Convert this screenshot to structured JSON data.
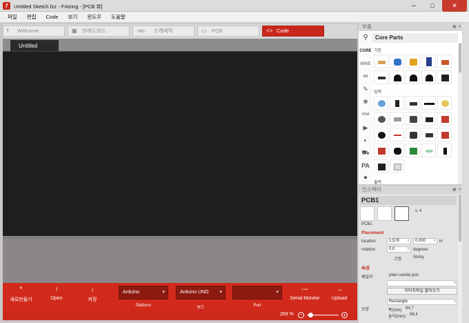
{
  "window": {
    "title": "Untitled Sketch.fzz - Fritzing - [PCB 뷰]",
    "logo_letter": "f",
    "minimize_icon": "─",
    "maximize_icon": "□",
    "close_icon": "✕"
  },
  "menu": [
    "파일",
    "편집",
    "Code",
    "보기",
    "윈도우",
    "도움말"
  ],
  "tabs": [
    {
      "label": "Welcome",
      "icon": "f"
    },
    {
      "label": "브레드보드",
      "icon": "▦"
    },
    {
      "label": "스케메틱",
      "icon": "-ᴧᴧ-"
    },
    {
      "label": "PCB",
      "icon": "▭"
    },
    {
      "label": "Code",
      "icon": "<>"
    }
  ],
  "document_tab": "Untitled",
  "toolbar": {
    "new": {
      "label": "새로만들기",
      "icon": "*"
    },
    "open": {
      "label": "Open",
      "icon": "↑"
    },
    "save": {
      "label": "저장",
      "icon": "↓"
    },
    "platform": {
      "value": "Arduino",
      "label": "Platform"
    },
    "board": {
      "value": "Arduino UNO",
      "label": "보드"
    },
    "port": {
      "value": "",
      "label": "Port"
    },
    "serial_monitor": {
      "label": "Serial Monitor",
      "icon": "---"
    },
    "upload": {
      "label": "Upload",
      "icon": "→"
    }
  },
  "status": {
    "zoom": "269 %",
    "zoom_out": "−",
    "zoom_in": "+"
  },
  "parts": {
    "title": "부품",
    "search_icon": "⚲",
    "bin_title": "Core Parts",
    "section_basic": "기본",
    "section_input": "입력",
    "section_bottom": "출력",
    "bins": [
      "CORE",
      "MINE",
      "∞",
      "✎",
      "❀",
      "intel",
      "▶",
      "◐",
      "⛟",
      "PA",
      "◆"
    ]
  },
  "inspector": {
    "title": "인스펙터",
    "part_title": "PCB1",
    "version": "v. 4",
    "name": "PCB1",
    "placement_heading": "Placement",
    "location_label": "location",
    "location_x": "1,578",
    "location_y": "0,000",
    "location_unit": "in",
    "rotation_label": "rotation",
    "rotation_value": "0,0",
    "rotation_unit": "degrees",
    "locked_label": "고정",
    "sticky_label": "Sticky",
    "properties_heading": "속성",
    "family_label": "패밀리",
    "family_value": "plain vanilla pcb",
    "load_image_button": "이미지파일 불러오기",
    "shape_label": "모양",
    "shape_value": "Rectangle",
    "width_label": "폭(mm)",
    "width_value": "84,7",
    "height_label": "높이(mm)",
    "height_value": "56,4"
  },
  "colors": {
    "accent": "#d1291b",
    "editor": "#1e1e1e",
    "console": "#8b8788"
  }
}
